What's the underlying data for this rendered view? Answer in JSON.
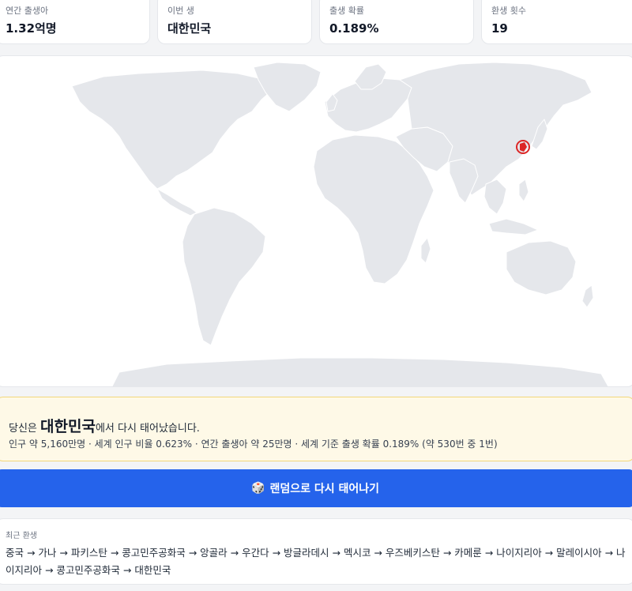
{
  "stats": [
    {
      "label": "연간 출생아",
      "value": "1.32억명"
    },
    {
      "label": "이번 생",
      "value": "대한민국"
    },
    {
      "label": "출생 확률",
      "value": "0.189%"
    },
    {
      "label": "환생 횟수",
      "value": "19"
    }
  ],
  "map": {
    "land_color": "#e5e7eb",
    "border_color": "#ffffff",
    "marker_color": "#dc2626",
    "marker_icon": "map-pin-icon"
  },
  "result": {
    "prefix": "당신은 ",
    "country": "대한민국",
    "suffix": "에서 다시 태어났습니다.",
    "details": "인구 약 5,160만명 · 세계 인구 비율 0.623% · 연간 출생아 약 25만명 · 세계 기준 출생 확률 0.189% (약 530번 중 1번)"
  },
  "reroll_button": {
    "icon": "dice-icon",
    "label": "랜덤으로 다시 태어나기"
  },
  "history": {
    "title": "최근 환생",
    "path": "중국 → 가나 → 파키스탄 → 콩고민주공화국 → 앙골라 → 우간다 → 방글라데시 → 멕시코 → 우즈베키스탄 → 카메룬 → 나이지리아 → 말레이시아 → 나이지리아 → 콩고민주공화국 → 대한민국"
  },
  "colors": {
    "accent": "#2563eb",
    "result_bg": "#fef9e7",
    "result_border": "#f3d77a"
  }
}
